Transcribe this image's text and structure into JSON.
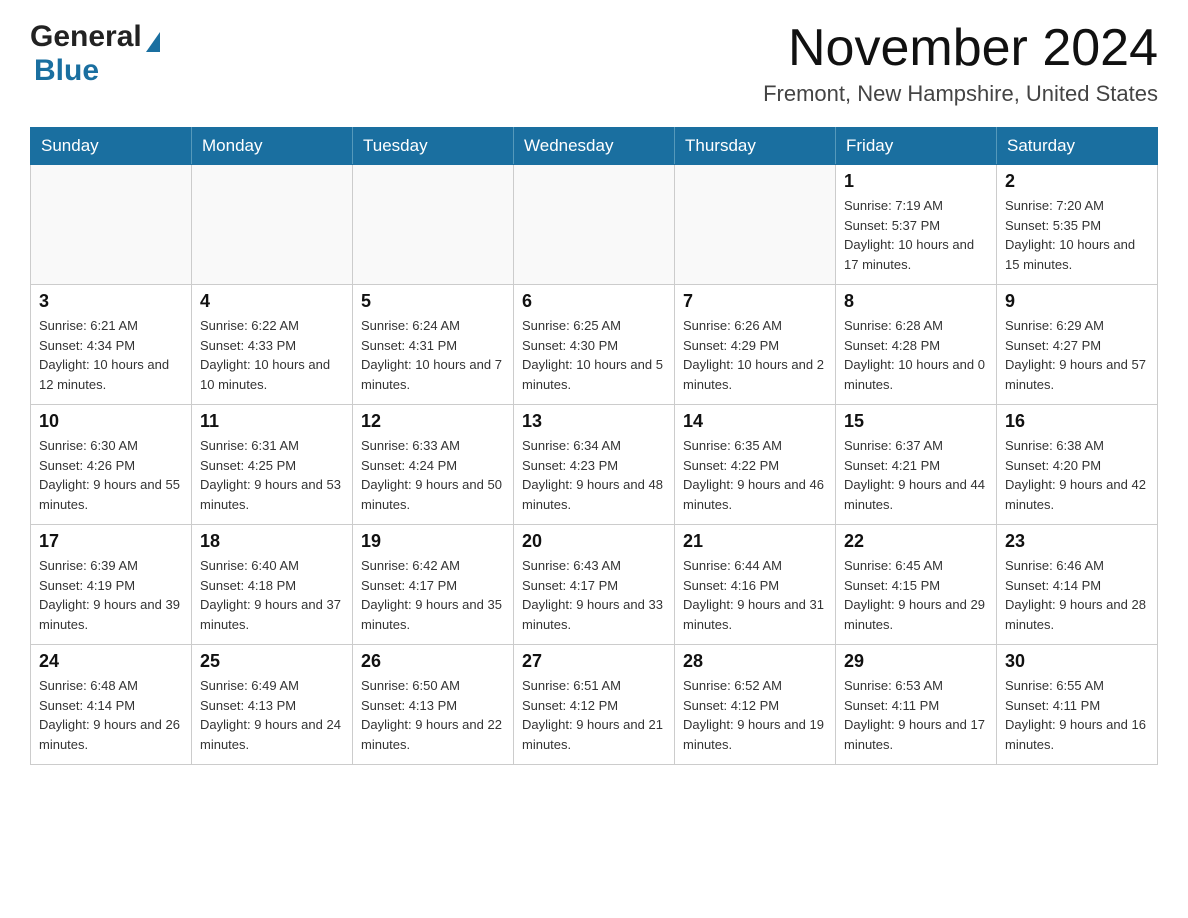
{
  "logo": {
    "general": "General",
    "blue": "Blue"
  },
  "title": {
    "month_year": "November 2024",
    "location": "Fremont, New Hampshire, United States"
  },
  "days_of_week": [
    "Sunday",
    "Monday",
    "Tuesday",
    "Wednesday",
    "Thursday",
    "Friday",
    "Saturday"
  ],
  "weeks": [
    [
      {
        "day": "",
        "sunrise": "",
        "sunset": "",
        "daylight": ""
      },
      {
        "day": "",
        "sunrise": "",
        "sunset": "",
        "daylight": ""
      },
      {
        "day": "",
        "sunrise": "",
        "sunset": "",
        "daylight": ""
      },
      {
        "day": "",
        "sunrise": "",
        "sunset": "",
        "daylight": ""
      },
      {
        "day": "",
        "sunrise": "",
        "sunset": "",
        "daylight": ""
      },
      {
        "day": "1",
        "sunrise": "Sunrise: 7:19 AM",
        "sunset": "Sunset: 5:37 PM",
        "daylight": "Daylight: 10 hours and 17 minutes."
      },
      {
        "day": "2",
        "sunrise": "Sunrise: 7:20 AM",
        "sunset": "Sunset: 5:35 PM",
        "daylight": "Daylight: 10 hours and 15 minutes."
      }
    ],
    [
      {
        "day": "3",
        "sunrise": "Sunrise: 6:21 AM",
        "sunset": "Sunset: 4:34 PM",
        "daylight": "Daylight: 10 hours and 12 minutes."
      },
      {
        "day": "4",
        "sunrise": "Sunrise: 6:22 AM",
        "sunset": "Sunset: 4:33 PM",
        "daylight": "Daylight: 10 hours and 10 minutes."
      },
      {
        "day": "5",
        "sunrise": "Sunrise: 6:24 AM",
        "sunset": "Sunset: 4:31 PM",
        "daylight": "Daylight: 10 hours and 7 minutes."
      },
      {
        "day": "6",
        "sunrise": "Sunrise: 6:25 AM",
        "sunset": "Sunset: 4:30 PM",
        "daylight": "Daylight: 10 hours and 5 minutes."
      },
      {
        "day": "7",
        "sunrise": "Sunrise: 6:26 AM",
        "sunset": "Sunset: 4:29 PM",
        "daylight": "Daylight: 10 hours and 2 minutes."
      },
      {
        "day": "8",
        "sunrise": "Sunrise: 6:28 AM",
        "sunset": "Sunset: 4:28 PM",
        "daylight": "Daylight: 10 hours and 0 minutes."
      },
      {
        "day": "9",
        "sunrise": "Sunrise: 6:29 AM",
        "sunset": "Sunset: 4:27 PM",
        "daylight": "Daylight: 9 hours and 57 minutes."
      }
    ],
    [
      {
        "day": "10",
        "sunrise": "Sunrise: 6:30 AM",
        "sunset": "Sunset: 4:26 PM",
        "daylight": "Daylight: 9 hours and 55 minutes."
      },
      {
        "day": "11",
        "sunrise": "Sunrise: 6:31 AM",
        "sunset": "Sunset: 4:25 PM",
        "daylight": "Daylight: 9 hours and 53 minutes."
      },
      {
        "day": "12",
        "sunrise": "Sunrise: 6:33 AM",
        "sunset": "Sunset: 4:24 PM",
        "daylight": "Daylight: 9 hours and 50 minutes."
      },
      {
        "day": "13",
        "sunrise": "Sunrise: 6:34 AM",
        "sunset": "Sunset: 4:23 PM",
        "daylight": "Daylight: 9 hours and 48 minutes."
      },
      {
        "day": "14",
        "sunrise": "Sunrise: 6:35 AM",
        "sunset": "Sunset: 4:22 PM",
        "daylight": "Daylight: 9 hours and 46 minutes."
      },
      {
        "day": "15",
        "sunrise": "Sunrise: 6:37 AM",
        "sunset": "Sunset: 4:21 PM",
        "daylight": "Daylight: 9 hours and 44 minutes."
      },
      {
        "day": "16",
        "sunrise": "Sunrise: 6:38 AM",
        "sunset": "Sunset: 4:20 PM",
        "daylight": "Daylight: 9 hours and 42 minutes."
      }
    ],
    [
      {
        "day": "17",
        "sunrise": "Sunrise: 6:39 AM",
        "sunset": "Sunset: 4:19 PM",
        "daylight": "Daylight: 9 hours and 39 minutes."
      },
      {
        "day": "18",
        "sunrise": "Sunrise: 6:40 AM",
        "sunset": "Sunset: 4:18 PM",
        "daylight": "Daylight: 9 hours and 37 minutes."
      },
      {
        "day": "19",
        "sunrise": "Sunrise: 6:42 AM",
        "sunset": "Sunset: 4:17 PM",
        "daylight": "Daylight: 9 hours and 35 minutes."
      },
      {
        "day": "20",
        "sunrise": "Sunrise: 6:43 AM",
        "sunset": "Sunset: 4:17 PM",
        "daylight": "Daylight: 9 hours and 33 minutes."
      },
      {
        "day": "21",
        "sunrise": "Sunrise: 6:44 AM",
        "sunset": "Sunset: 4:16 PM",
        "daylight": "Daylight: 9 hours and 31 minutes."
      },
      {
        "day": "22",
        "sunrise": "Sunrise: 6:45 AM",
        "sunset": "Sunset: 4:15 PM",
        "daylight": "Daylight: 9 hours and 29 minutes."
      },
      {
        "day": "23",
        "sunrise": "Sunrise: 6:46 AM",
        "sunset": "Sunset: 4:14 PM",
        "daylight": "Daylight: 9 hours and 28 minutes."
      }
    ],
    [
      {
        "day": "24",
        "sunrise": "Sunrise: 6:48 AM",
        "sunset": "Sunset: 4:14 PM",
        "daylight": "Daylight: 9 hours and 26 minutes."
      },
      {
        "day": "25",
        "sunrise": "Sunrise: 6:49 AM",
        "sunset": "Sunset: 4:13 PM",
        "daylight": "Daylight: 9 hours and 24 minutes."
      },
      {
        "day": "26",
        "sunrise": "Sunrise: 6:50 AM",
        "sunset": "Sunset: 4:13 PM",
        "daylight": "Daylight: 9 hours and 22 minutes."
      },
      {
        "day": "27",
        "sunrise": "Sunrise: 6:51 AM",
        "sunset": "Sunset: 4:12 PM",
        "daylight": "Daylight: 9 hours and 21 minutes."
      },
      {
        "day": "28",
        "sunrise": "Sunrise: 6:52 AM",
        "sunset": "Sunset: 4:12 PM",
        "daylight": "Daylight: 9 hours and 19 minutes."
      },
      {
        "day": "29",
        "sunrise": "Sunrise: 6:53 AM",
        "sunset": "Sunset: 4:11 PM",
        "daylight": "Daylight: 9 hours and 17 minutes."
      },
      {
        "day": "30",
        "sunrise": "Sunrise: 6:55 AM",
        "sunset": "Sunset: 4:11 PM",
        "daylight": "Daylight: 9 hours and 16 minutes."
      }
    ]
  ]
}
